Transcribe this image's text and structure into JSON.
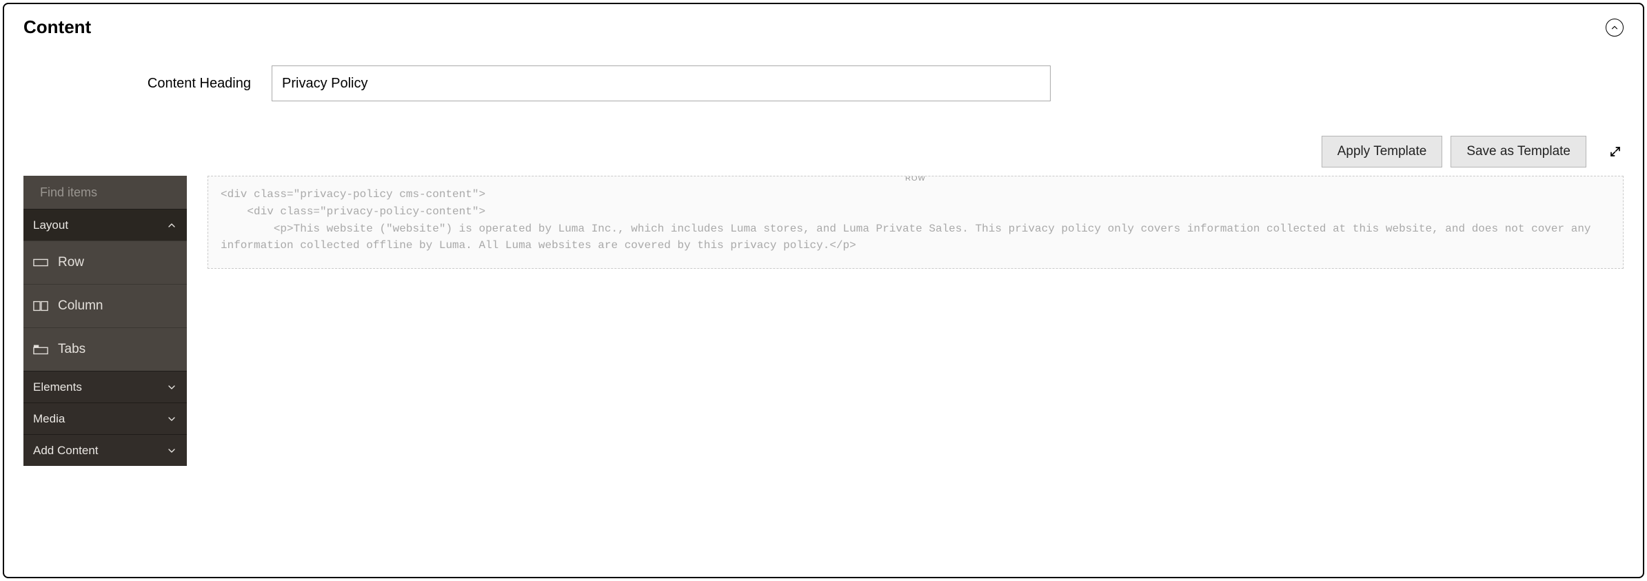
{
  "panel": {
    "title": "Content"
  },
  "heading": {
    "label": "Content Heading",
    "value": "Privacy Policy"
  },
  "toolbar": {
    "apply_template": "Apply Template",
    "save_template": "Save as Template"
  },
  "sidebar": {
    "search_placeholder": "Find items",
    "groups": {
      "layout": {
        "label": "Layout",
        "expanded": true
      },
      "elements": {
        "label": "Elements",
        "expanded": false
      },
      "media": {
        "label": "Media",
        "expanded": false
      },
      "add_content": {
        "label": "Add Content",
        "expanded": false
      }
    },
    "layout_blocks": {
      "row": "Row",
      "column": "Column",
      "tabs": "Tabs"
    }
  },
  "canvas": {
    "row_badge": "ROW",
    "code": "<div class=\"privacy-policy cms-content\">\n    <div class=\"privacy-policy-content\">\n        <p>This website (\"website\") is operated by Luma Inc., which includes Luma stores, and Luma Private Sales. This privacy policy only covers information collected at this website, and does not cover any information collected offline by Luma. All Luma websites are covered by this privacy policy.</p>"
  }
}
